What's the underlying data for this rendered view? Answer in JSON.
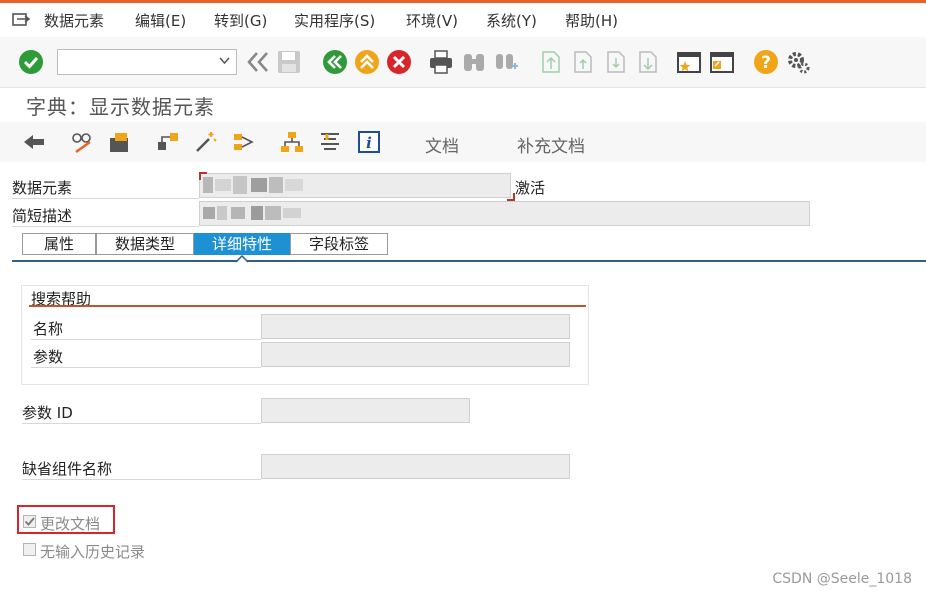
{
  "menu": {
    "items": [
      {
        "label": "数据元素"
      },
      {
        "label": "编辑(E)"
      },
      {
        "label": "转到(G)"
      },
      {
        "label": "实用程序(S)"
      },
      {
        "label": "环境(V)"
      },
      {
        "label": "系统(Y)"
      },
      {
        "label": "帮助(H)"
      }
    ]
  },
  "toolbar": {
    "command_field_value": ""
  },
  "page": {
    "title": "字典：显示数据元素"
  },
  "app_toolbar": {
    "doc_label": "文档",
    "supplementary_doc_label": "补充文档"
  },
  "fields": {
    "data_element_label": "数据元素",
    "data_element_status": "激活",
    "short_desc_label": "简短描述"
  },
  "tabs": [
    {
      "label": "属性",
      "active": false
    },
    {
      "label": "数据类型",
      "active": false
    },
    {
      "label": "详细特性",
      "active": true
    },
    {
      "label": "字段标签",
      "active": false
    }
  ],
  "search_help": {
    "group_title": "搜索帮助",
    "name_label": "名称",
    "param_label": "参数"
  },
  "param_id_label": "参数 ID",
  "default_component_label": "缺省组件名称",
  "checkboxes": {
    "change_doc_label": "更改文档",
    "change_doc_checked": true,
    "no_history_label": "无输入历史记录",
    "no_history_checked": false
  },
  "watermark": "CSDN @Seele_1018",
  "colors": {
    "accent": "#e8632a",
    "tab_active": "#1d91d1",
    "group_line": "#c0532b",
    "highlight": "#d7262b"
  }
}
